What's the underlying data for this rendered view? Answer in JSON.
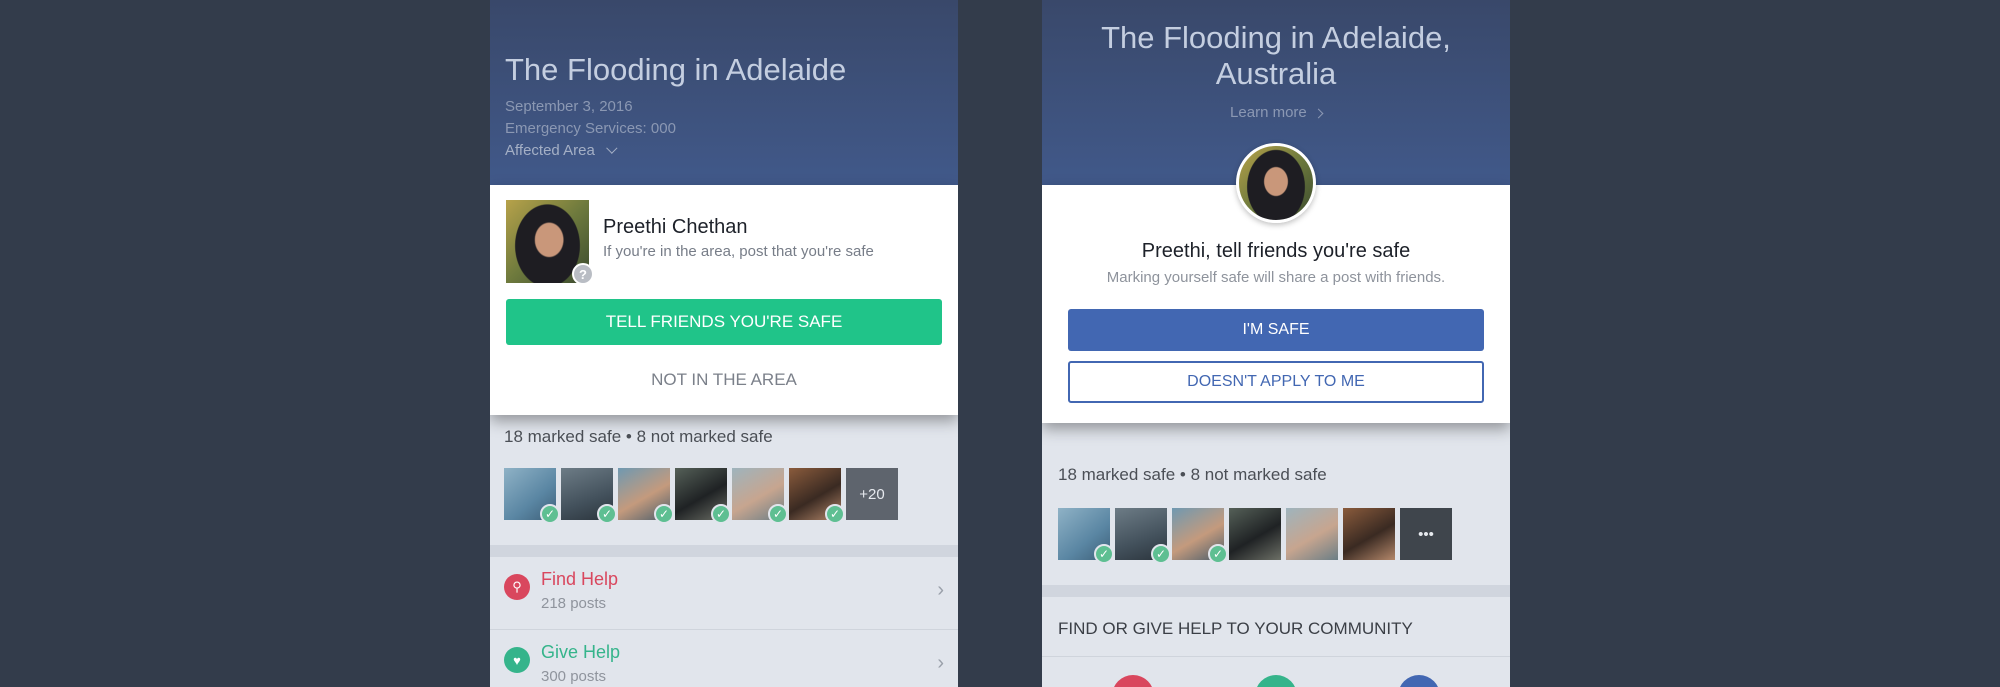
{
  "left": {
    "header": {
      "title": "The Flooding in Adelaide",
      "date": "September 3, 2016",
      "emergency": "Emergency Services: 000",
      "affected": "Affected Area"
    },
    "card": {
      "name": "Preethi Chethan",
      "subtitle": "If you're in the area, post that you're safe",
      "badge": "?",
      "primary_button": "TELL FRIENDS YOU'RE SAFE",
      "secondary_button": "NOT IN THE AREA"
    },
    "stats": {
      "counts": "18 marked safe • 8 not marked safe",
      "more": "+20"
    },
    "help": [
      {
        "label": "Find Help",
        "count": "218 posts",
        "color": "#d9475e"
      },
      {
        "label": "Give Help",
        "count": "300 posts",
        "color": "#35b48b"
      }
    ]
  },
  "right": {
    "header": {
      "title_line1": "The Flooding in Adelaide,",
      "title_line2": "Australia",
      "learn_more": "Learn more"
    },
    "card": {
      "headline": "Preethi, tell friends you're safe",
      "subtitle": "Marking yourself safe will share a post with friends.",
      "primary_button": "I'M SAFE",
      "secondary_button": "DOESN'T APPLY TO ME"
    },
    "stats": {
      "counts": "18 marked safe • 8 not marked safe",
      "more": "•••"
    },
    "community": "FIND OR GIVE HELP TO YOUR COMMUNITY"
  },
  "colors": {
    "background": "#333c4b",
    "safe_green": "#20c489",
    "facebook_blue": "#4267b2",
    "check_green": "#5ebf92"
  }
}
